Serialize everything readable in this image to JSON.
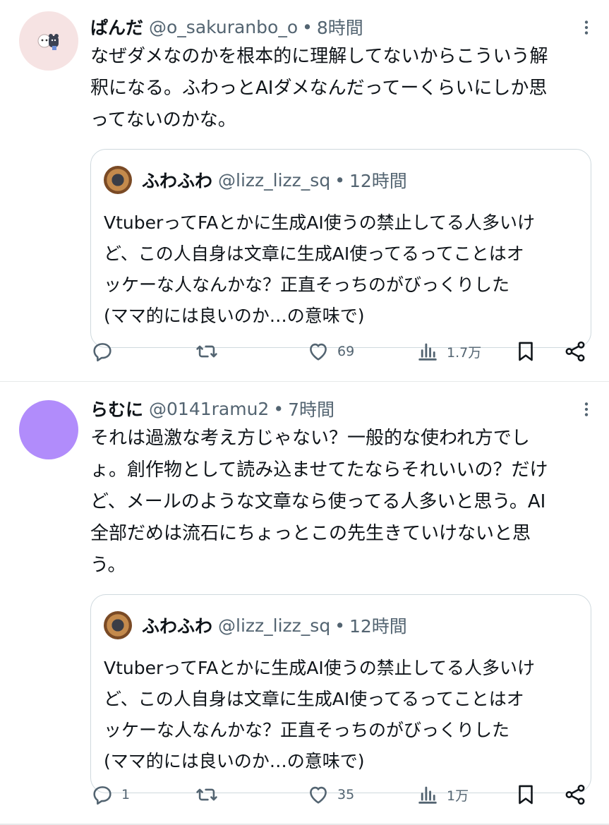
{
  "tweets": [
    {
      "name": "ぱんだ",
      "handle": "@o_sakuranbo_o",
      "dot": "•",
      "time": "8時間",
      "text": "なぜダメなのかを根本的に理解してないからこういう解\n釈になる。ふわっとAIダメなんだってーくらいにしか思\nってないのかな。",
      "avatar_color": "#f6e3e3",
      "quote": {
        "name": "ふわふわ",
        "handle": "@lizz_lizz_sq",
        "dot": "•",
        "time": "12時間",
        "text": "VtuberってFAとかに生成AI使うの禁止してる人多いけ\nど、この人自身は文章に生成AI使ってるってことはオ\nッケーな人なんかな？正直そっちのがびっくりした\n(ママ的には良いのか…の意味で)"
      },
      "actions": {
        "reply": "",
        "retweet": "",
        "like": "69",
        "views": "1.7万"
      }
    },
    {
      "name": "らむに",
      "handle": "@0141ramu2",
      "dot": "•",
      "time": "7時間",
      "text": "それは過激な考え方じゃない？一般的な使われ方でし\nょ。創作物として読み込ませてたならそれいいの？だけ\nど、メールのような文章なら使ってる人多いと思う。AI\n全部だめは流石にちょっとこの先生きていけないと思\nう。",
      "avatar_color": "#b18cfb",
      "quote": {
        "name": "ふわふわ",
        "handle": "@lizz_lizz_sq",
        "dot": "•",
        "time": "12時間",
        "text": "VtuberってFAとかに生成AI使うの禁止してる人多いけ\nど、この人自身は文章に生成AI使ってるってことはオ\nッケーな人なんかな？正直そっちのがびっくりした\n(ママ的には良いのか…の意味で)"
      },
      "actions": {
        "reply": "1",
        "retweet": "",
        "like": "35",
        "views": "1万"
      }
    }
  ],
  "icons": {
    "reply": "reply-icon",
    "retweet": "retweet-icon",
    "like": "like-icon",
    "views": "views-icon",
    "bookmark": "bookmark-icon",
    "share": "share-icon",
    "more": "more-icon"
  },
  "colors": {
    "secondary_text": "#536471",
    "border": "#cfd9de",
    "text": "#0f1419"
  }
}
